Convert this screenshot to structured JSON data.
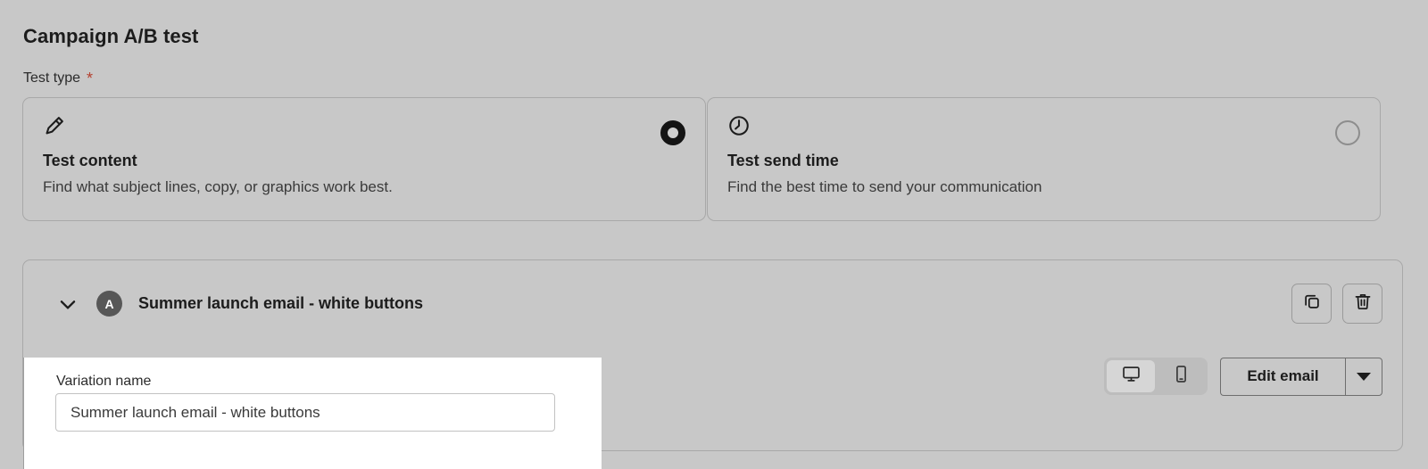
{
  "page": {
    "title": "Campaign A/B test"
  },
  "test_type": {
    "label": "Test type",
    "required_marker": "*",
    "options": [
      {
        "icon": "pencil-icon",
        "title": "Test content",
        "description": "Find what subject lines, copy, or graphics work best.",
        "selected": true
      },
      {
        "icon": "clock-icon",
        "title": "Test send time",
        "description": "Find the best time to send your communication",
        "selected": false
      }
    ]
  },
  "variation": {
    "badge": "A",
    "title": "Summer launch email - white buttons",
    "collapse_icon": "chevron-down-icon",
    "duplicate_icon": "copy-icon",
    "delete_icon": "trash-icon",
    "devices": [
      {
        "name": "desktop-icon",
        "active": true
      },
      {
        "name": "mobile-icon",
        "active": false
      }
    ],
    "edit_email_label": "Edit email",
    "edit_email_caret_icon": "chevron-down-icon"
  },
  "variation_form": {
    "name_label": "Variation name",
    "name_value": "Summer launch email - white buttons",
    "name_placeholder": "Variation name"
  },
  "colors": {
    "background": "#c8c8c8",
    "panel": "#ffffff",
    "text": "#1c1c1c",
    "muted_text": "#3a3a3a",
    "border": "#a8a8a8",
    "required_star": "#b4402f",
    "badge": "#575757"
  }
}
